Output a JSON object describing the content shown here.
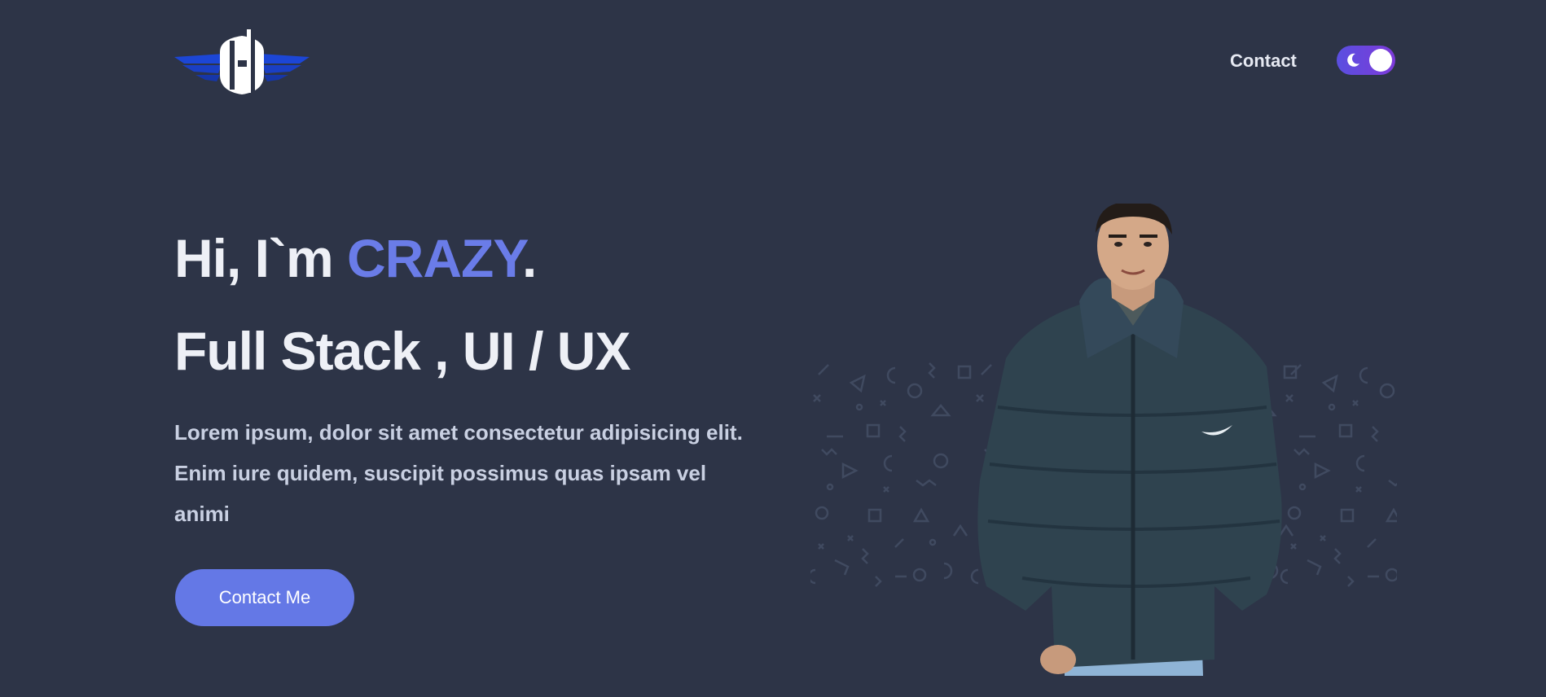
{
  "header": {
    "logo_icon": "winged-h-logo",
    "nav": {
      "contact_label": "Contact"
    },
    "theme_toggle": {
      "icon": "moon-icon",
      "state": "dark"
    }
  },
  "hero": {
    "greeting_prefix": "Hi, I`m ",
    "name": "CRAZY",
    "greeting_suffix": ".",
    "role": "Full Stack , UI / UX",
    "description": "Lorem ipsum, dolor sit amet consectetur adipisicing elit. Enim iure quidem, suscipit possimus quas ipsam vel animi",
    "cta_label": "Contact Me",
    "portrait_icon": "person-portrait",
    "pattern_icon": "geometric-pattern"
  },
  "colors": {
    "background": "#2d3447",
    "accent": "#6a7ce8",
    "button": "#6478e6",
    "logo_blue": "#1c46d6",
    "toggle_start": "#5a4fe0",
    "toggle_end": "#7d3ad9"
  }
}
